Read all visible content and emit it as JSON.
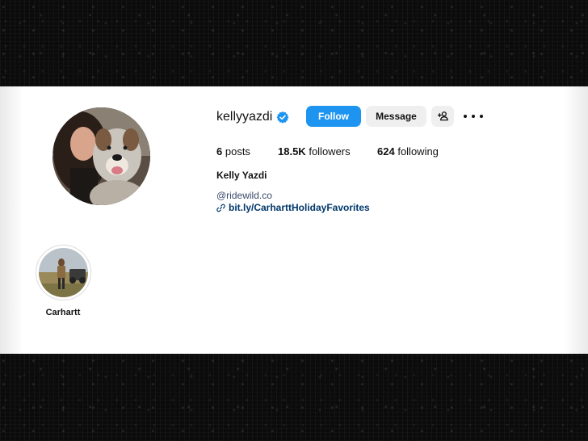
{
  "profile": {
    "username": "kellyyazdi",
    "full_name": "Kelly Yazdi",
    "verified_icon": "verified-badge-icon",
    "accent_color": "#1d95f0"
  },
  "actions": {
    "follow_label": "Follow",
    "message_label": "Message",
    "add_user_icon": "person-add-icon",
    "more_icon": "more-options-icon"
  },
  "stats": {
    "posts_count": "6",
    "posts_label": "posts",
    "followers_count": "18.5K",
    "followers_label": "followers",
    "following_count": "624",
    "following_label": "following"
  },
  "bio": {
    "handle_link": "@ridewild.co",
    "url_link": "bit.ly/CarharttHolidayFavorites",
    "link_icon": "link-icon"
  },
  "highlights": [
    {
      "label": "Carhartt"
    }
  ]
}
